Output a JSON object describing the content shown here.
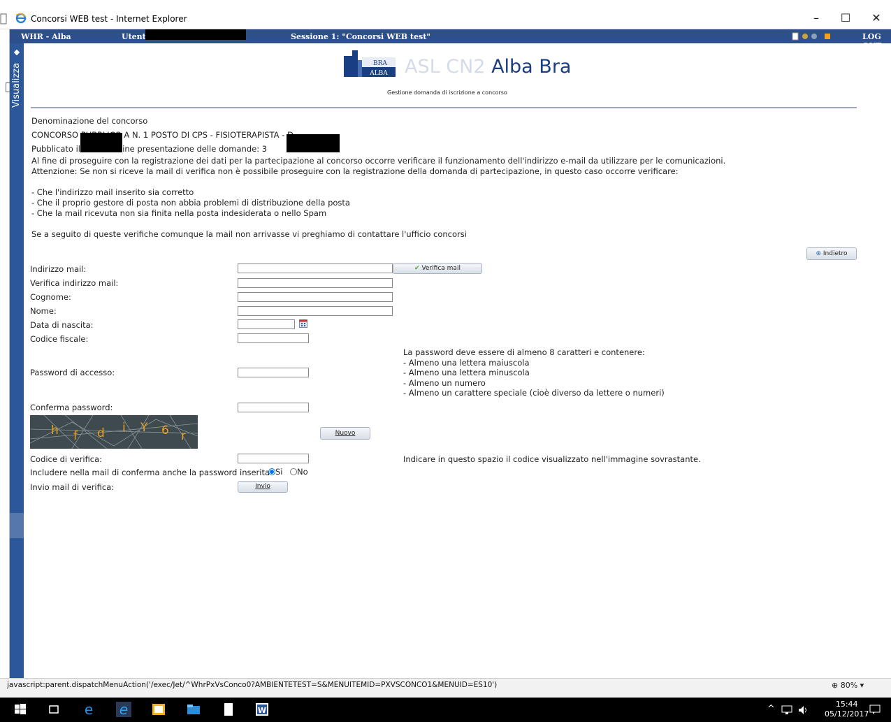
{
  "window": {
    "title": "Concorsi WEB test - Internet Explorer",
    "minimize": "–",
    "maximize": "☐",
    "close": "✕"
  },
  "appbar": {
    "app_name": "WHR - Alba",
    "user_label": "Utente",
    "session": "Sessione 1: \"Concorsi WEB test\"",
    "logout": "LOG OUT"
  },
  "sidebar": {
    "label": "Visualizza"
  },
  "header": {
    "logo_top": "BRA",
    "logo_bottom": "ALBA",
    "org_faded": "ASL CN2",
    "org_brand": "Alba Bra",
    "subtitle": "Gestione domanda di iscrizione a concorso"
  },
  "content": {
    "denomination_label": "Denominazione del concorso",
    "competition_title": "CONCORSO PUBBLICO A N. 1 POSTO DI CPS - FISIOTERAPISTA - D",
    "published": "Pubblicato il 0      17 termine presentazione delle domande: 3",
    "intro_line1": "Al fine di proseguire con la registrazione dei dati per la partecipazione al concorso occorre verificare il funzionamento dell'indirizzo e-mail da utilizzare per le comunicazioni.",
    "intro_line2": "Attenzione: Se non si riceve la mail di verifica non è possibile proseguire con la registrazione della domanda di partecipazione, in questo caso occorre verificare:",
    "check1": "- Che l'indirizzo mail inserito sia corretto",
    "check2": "- Che il proprio gestore di posta non abbia problemi di distribuzione della posta",
    "check3": "- Che la mail ricevuta non sia finita nella posta indesiderata o nello Spam",
    "contact": "Se a seguito di queste verifiche comunque la mail non arrivasse vi preghiamo di contattare l'ufficio concorsi"
  },
  "buttons": {
    "back": "Indietro",
    "verify_mail": "Verifica mail",
    "new_captcha": "Nuovo",
    "send": "Invio"
  },
  "form": {
    "email_label": "Indirizzo mail:",
    "email_confirm_label": "Verifica indirizzo mail:",
    "surname_label": "Cognome:",
    "name_label": "Nome:",
    "birthdate_label": "Data di nascita:",
    "tax_code_label": "Codice fiscale:",
    "password_label": "Password di accesso:",
    "password_confirm_label": "Conferma password:",
    "verify_code_label": "Codice di verifica:",
    "include_password_label": "Includere nella mail di conferma anche la password inserita",
    "include_yes": "Si",
    "include_no": "No",
    "include_selected": "Si",
    "send_mail_label": "Invio mail di verifica:",
    "verify_code_hint": "Indicare in questo spazio il codice visualizzato nell'immagine sovrastante."
  },
  "password_rules": {
    "intro": "La password deve essere di almeno 8 caratteri e contenere:",
    "rule1": "- Almeno una lettera maiuscola",
    "rule2": "- Almeno una lettera minuscola",
    "rule3": "- Almeno un numero",
    "rule4": "- Almeno un carattere speciale (cioè diverso da lettere o numeri)"
  },
  "captcha": {
    "chars": [
      "h",
      "f",
      "d",
      "i",
      "Y",
      "6",
      "r"
    ]
  },
  "statusbar": {
    "url": "javascript:parent.dispatchMenuAction('/exec/Jet/^WhrPxVsConco0?AMBIENTETEST=S&MENUITEMID=PXVSCONCO1&MENUID=ES10')",
    "zoom": "80%"
  },
  "taskbar": {
    "time": "15:44",
    "date": "05/12/2017"
  },
  "colors": {
    "appbar": "#2d4f8c",
    "sidebar": "#2c5799",
    "brand": "#1a3e82",
    "captcha_text": "#e6a01e"
  }
}
